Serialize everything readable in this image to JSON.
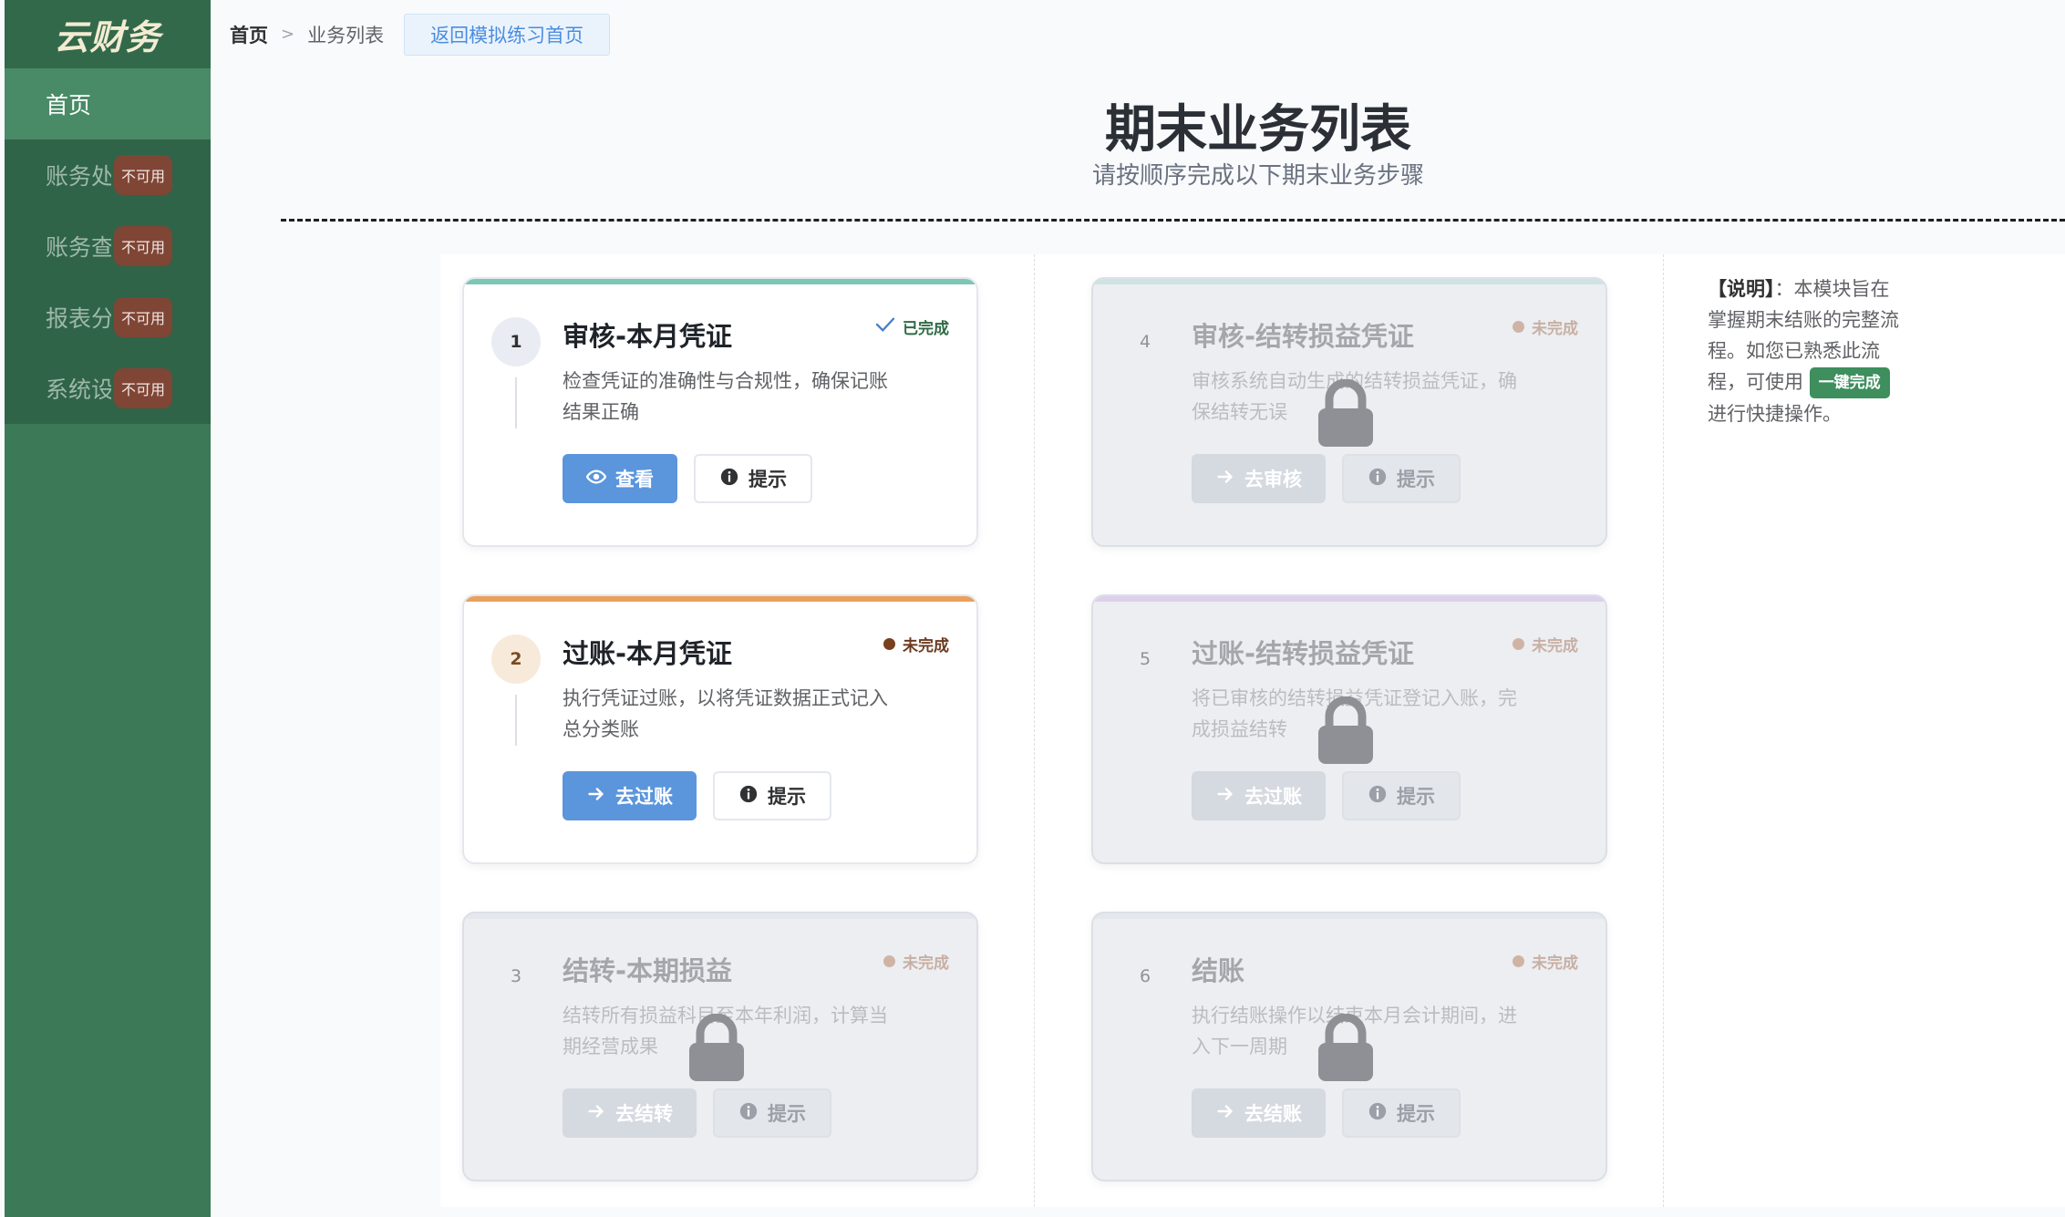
{
  "app": {
    "logo": "云财务"
  },
  "sidebar": {
    "items": [
      {
        "label": "首页",
        "active": true
      },
      {
        "label": "账务处理",
        "badge": "不可用"
      },
      {
        "label": "账务查询",
        "badge": "不可用"
      },
      {
        "label": "报表分析",
        "badge": "不可用"
      },
      {
        "label": "系统设置",
        "badge": "不可用"
      }
    ]
  },
  "breadcrumb": {
    "home": "首页",
    "separator": ">",
    "current": "业务列表",
    "back": "返回模拟练习首页"
  },
  "header": {
    "title": "期末业务列表",
    "subtitle": "请按顺序完成以下期末业务步骤"
  },
  "cards": [
    {
      "num": "1",
      "title": "审核-本月凭证",
      "desc": "检查凭证的准确性与合规性，确保记账结果正确",
      "status": "已完成",
      "primary": "查看",
      "hint": "提示",
      "locked": false,
      "accent": "#7cc7b4",
      "primary_icon": "eye-icon"
    },
    {
      "num": "2",
      "title": "过账-本月凭证",
      "desc": "执行凭证过账，以将凭证数据正式记入总分类账",
      "status": "未完成",
      "primary": "去过账",
      "hint": "提示",
      "locked": false,
      "accent": "#e9a05c",
      "primary_icon": "arrow-right-icon"
    },
    {
      "num": "3",
      "title": "结转-本期损益",
      "desc": "结转所有损益科目至本年利润，计算当期经营成果",
      "status": "未完成",
      "primary": "去结转",
      "hint": "提示",
      "locked": true,
      "accent": "#e4e7ed",
      "primary_icon": "arrow-right-icon"
    },
    {
      "num": "4",
      "title": "审核-结转损益凭证",
      "desc": "审核系统自动生成的结转损益凭证，确保结转无误",
      "status": "未完成",
      "primary": "去审核",
      "hint": "提示",
      "locked": true,
      "accent": "#cfe3e3",
      "primary_icon": "arrow-right-icon"
    },
    {
      "num": "5",
      "title": "过账-结转损益凭证",
      "desc": "将已审核的结转损益凭证登记入账，完成损益结转",
      "status": "未完成",
      "primary": "去过账",
      "hint": "提示",
      "locked": true,
      "accent": "#ddd0ea",
      "primary_icon": "arrow-right-icon"
    },
    {
      "num": "6",
      "title": "结账",
      "desc": "执行结账操作以结束本月会计期间，进入下一周期",
      "status": "未完成",
      "primary": "去结账",
      "hint": "提示",
      "locked": true,
      "accent": "#e4e7ed",
      "primary_icon": "arrow-right-icon"
    }
  ],
  "note": {
    "label": "【说明】",
    "colon": "：",
    "text1": "本模块旨在掌握期末结账的完整流程。如您已熟悉此流程，可使用",
    "quick": "一键完成",
    "text2": "进行快捷操作。"
  },
  "colors": {
    "sidebar": "#3c7a57",
    "primary": "#5b95dc",
    "done": "#2e6b45",
    "todo": "#7a3f1d"
  }
}
